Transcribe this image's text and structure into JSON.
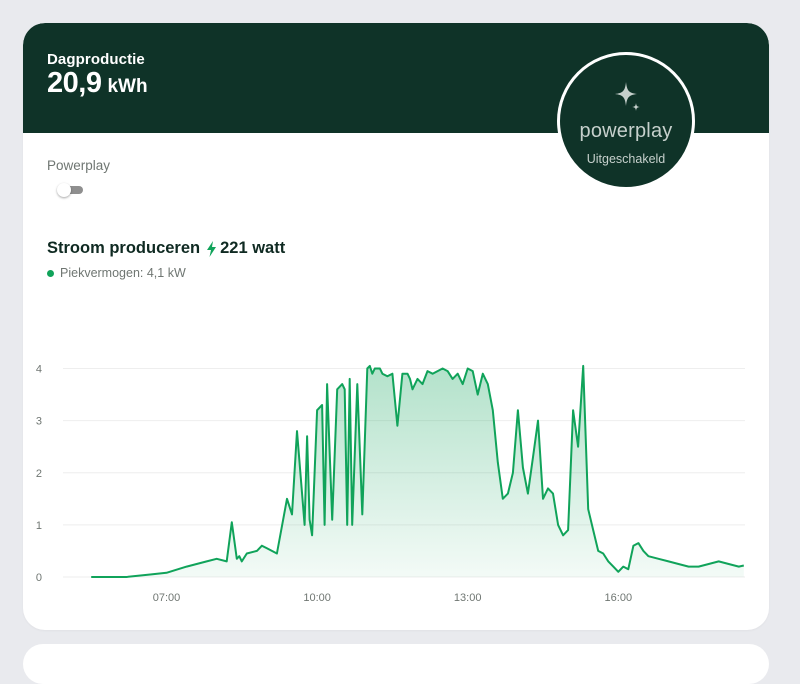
{
  "header": {
    "label": "Dagproductie",
    "value": "20,9",
    "unit": "kWh"
  },
  "powerplay_badge": {
    "name": "powerplay",
    "status": "Uitgeschakeld"
  },
  "toggle": {
    "label": "Powerplay",
    "enabled": false
  },
  "production": {
    "title": "Stroom produceren",
    "value": "221 watt",
    "peak_label": "Piekvermogen: 4,1 kW"
  },
  "colors": {
    "header_bg": "#0f3328",
    "accent": "#10a35a",
    "page_bg": "#e9eaee"
  },
  "chart_data": {
    "type": "area",
    "x_unit": "hours",
    "xticks": [
      {
        "value": 7,
        "label": "07:00"
      },
      {
        "value": 10,
        "label": "10:00"
      },
      {
        "value": 13,
        "label": "13:00"
      },
      {
        "value": 16,
        "label": "16:00"
      }
    ],
    "yticks": [
      0,
      1,
      2,
      3,
      4
    ],
    "ylim": [
      0,
      4.2
    ],
    "xlim": [
      5.5,
      19.0
    ],
    "grid": true,
    "series": [
      {
        "x": [
          5.5,
          6.2,
          6.7,
          7.0,
          7.4,
          7.8,
          8.0,
          8.2,
          8.3,
          8.4,
          8.45,
          8.5,
          8.6,
          8.8,
          8.9,
          9.0,
          9.2,
          9.4,
          9.5,
          9.6,
          9.75,
          9.8,
          9.85,
          9.9,
          10.0,
          10.1,
          10.15,
          10.2,
          10.3,
          10.4,
          10.5,
          10.55,
          10.6,
          10.65,
          10.7,
          10.8,
          10.9,
          11.0,
          11.05,
          11.1,
          11.15,
          11.2,
          11.25,
          11.3,
          11.4,
          11.5,
          11.6,
          11.7,
          11.8,
          11.85,
          11.9,
          12.0,
          12.1,
          12.2,
          12.3,
          12.4,
          12.5,
          12.6,
          12.7,
          12.8,
          12.9,
          13.0,
          13.1,
          13.2,
          13.3,
          13.4,
          13.5,
          13.6,
          13.7,
          13.8,
          13.9,
          14.0,
          14.1,
          14.2,
          14.3,
          14.4,
          14.5,
          14.6,
          14.7,
          14.8,
          14.9,
          15.0,
          15.1,
          15.2,
          15.3,
          15.4,
          15.5,
          15.55,
          15.6,
          15.7,
          15.8,
          15.9,
          16.0,
          16.1,
          16.2,
          16.3,
          16.4,
          16.5,
          16.6,
          16.8,
          17.0,
          17.2,
          17.4,
          17.6,
          17.8,
          18.0,
          18.2,
          18.4,
          18.5
        ],
        "y": [
          0,
          0,
          0.05,
          0.08,
          0.2,
          0.3,
          0.35,
          0.3,
          1.05,
          0.35,
          0.4,
          0.3,
          0.45,
          0.5,
          0.6,
          0.55,
          0.45,
          1.5,
          1.2,
          2.8,
          1.0,
          2.7,
          1.1,
          0.8,
          3.2,
          3.3,
          1.0,
          3.7,
          1.1,
          3.6,
          3.7,
          3.6,
          1.0,
          3.8,
          1.0,
          3.7,
          1.2,
          4.0,
          4.05,
          3.9,
          4.0,
          4.0,
          4.0,
          3.9,
          3.85,
          3.9,
          2.9,
          3.9,
          3.9,
          3.8,
          3.6,
          3.8,
          3.7,
          3.95,
          3.9,
          3.95,
          4.0,
          3.95,
          3.8,
          3.9,
          3.7,
          4.0,
          3.95,
          3.5,
          3.9,
          3.7,
          3.2,
          2.2,
          1.5,
          1.6,
          2.0,
          3.2,
          2.1,
          1.6,
          2.3,
          3.0,
          1.5,
          1.7,
          1.6,
          1.0,
          0.8,
          0.9,
          3.2,
          2.5,
          4.05,
          1.3,
          0.9,
          0.7,
          0.5,
          0.45,
          0.3,
          0.2,
          0.1,
          0.2,
          0.15,
          0.6,
          0.65,
          0.5,
          0.4,
          0.35,
          0.3,
          0.25,
          0.2,
          0.2,
          0.25,
          0.3,
          0.25,
          0.2,
          0.22
        ]
      }
    ]
  }
}
